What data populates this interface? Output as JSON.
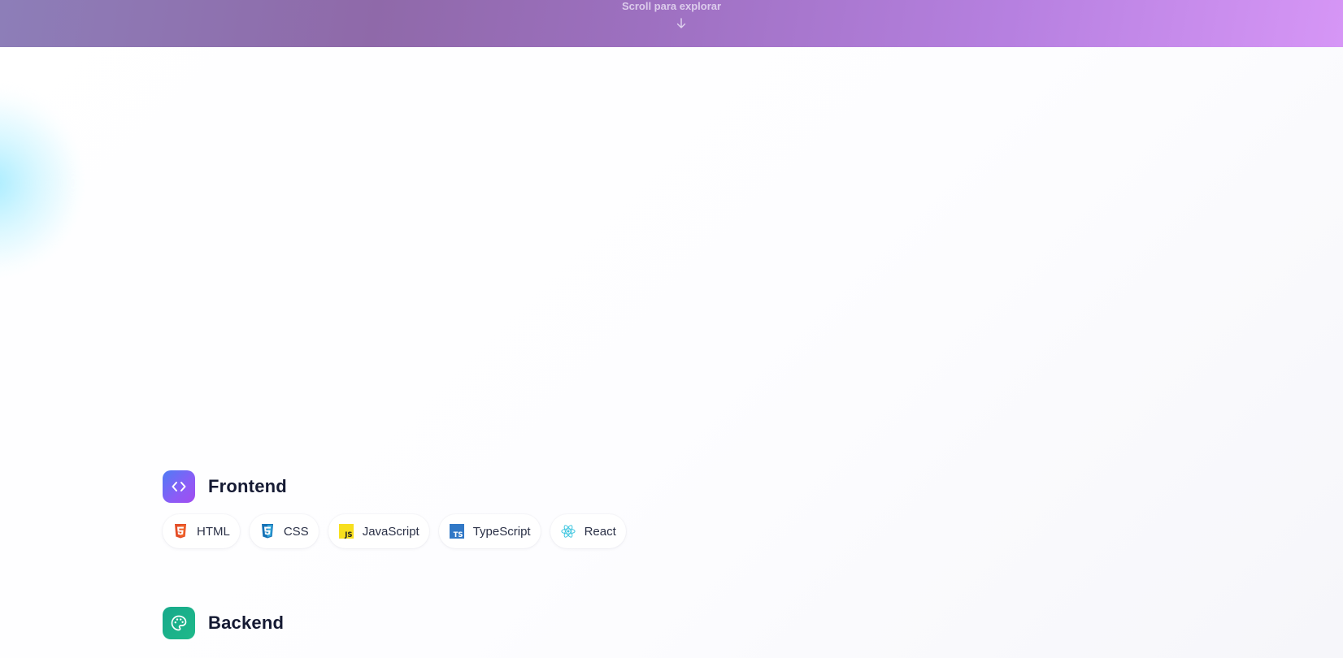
{
  "hero": {
    "scroll_hint": "Scroll para explorar",
    "arrow_icon": "arrow-down-icon"
  },
  "sections": [
    {
      "title": "Frontend",
      "icon": "code-brackets-icon",
      "accent": "#7c5cf6",
      "skills": [
        {
          "label": "HTML",
          "icon": "html5-icon",
          "color": "#e44d26"
        },
        {
          "label": "CSS",
          "icon": "css3-icon",
          "color": "#1572b6"
        },
        {
          "label": "JavaScript",
          "icon": "javascript-icon",
          "color": "#f7df1e"
        },
        {
          "label": "TypeScript",
          "icon": "typescript-icon",
          "color": "#3178c6"
        },
        {
          "label": "React",
          "icon": "react-icon",
          "color": "#3fc6e0"
        }
      ]
    },
    {
      "title": "Backend",
      "icon": "palette-icon",
      "accent": "#17a98b"
    }
  ]
}
